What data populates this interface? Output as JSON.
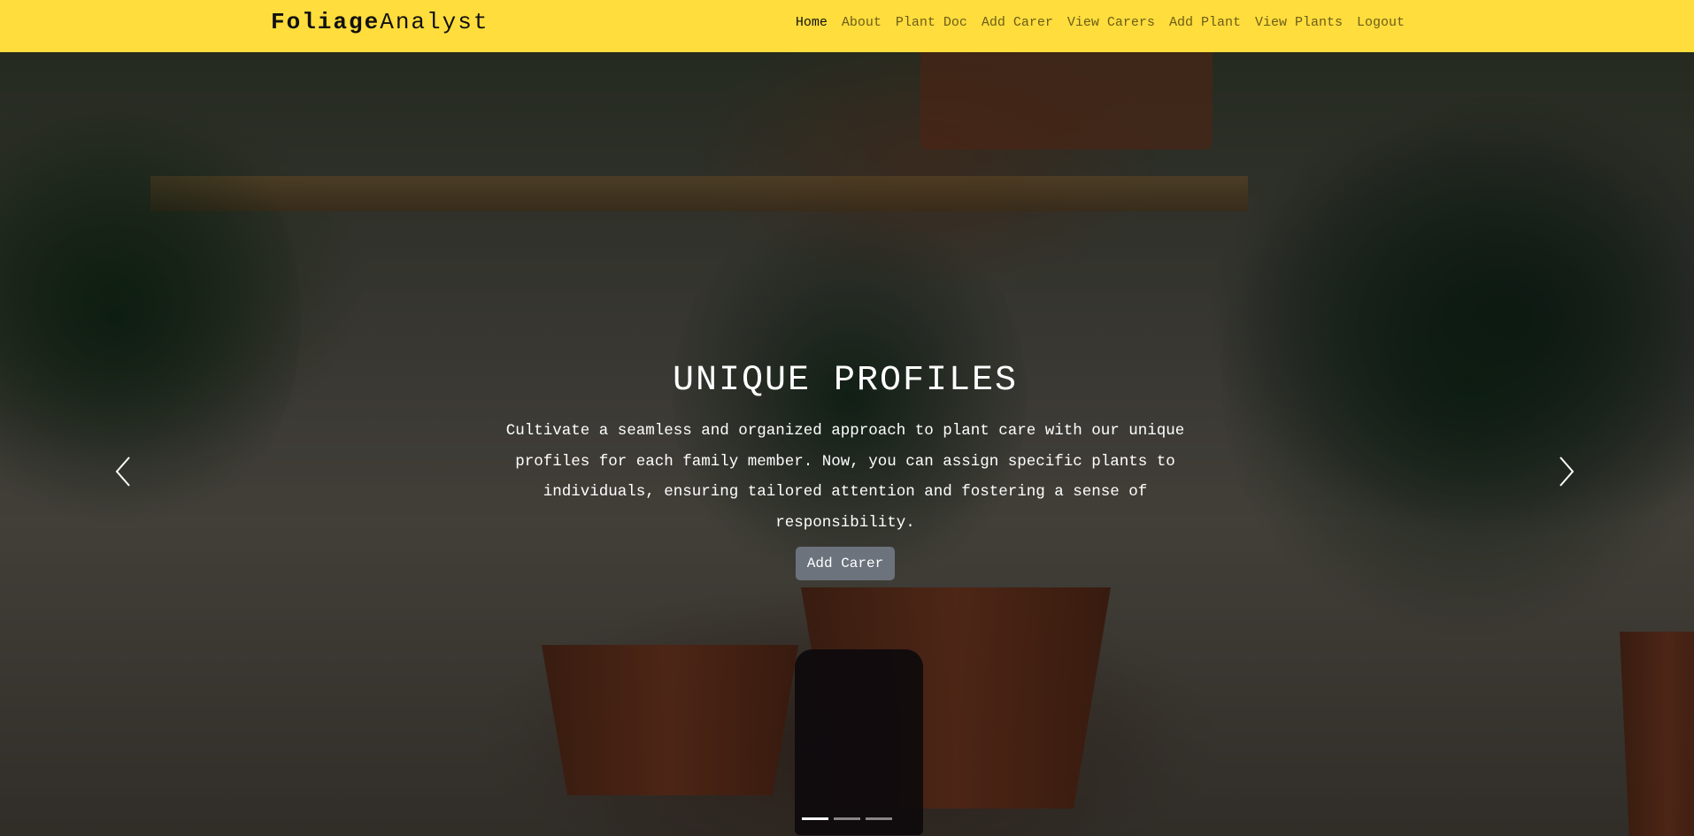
{
  "nav": {
    "brand_bold": "Foliage",
    "brand_rest": "Analyst",
    "links": [
      "Home",
      "About",
      "Plant Doc",
      "Add Carer",
      "View Carers",
      "Add Plant",
      "View Plants",
      "Logout"
    ],
    "active_index": 0
  },
  "hero": {
    "title": "UNIQUE PROFILES",
    "description_lines": [
      "Cultivate a seamless and organized approach to plant care with our unique",
      "profiles for each family member. Now, you can assign specific plants to",
      "individuals, ensuring tailored attention and fostering a sense of",
      "responsibility."
    ],
    "button_label": "Add Carer",
    "slide_count": 3,
    "active_slide": 0,
    "prev_icon": "chevron-left-icon",
    "next_icon": "chevron-right-icon"
  },
  "colors": {
    "navbar_bg": "#ffdd3c",
    "button_bg": "#6c737d"
  }
}
